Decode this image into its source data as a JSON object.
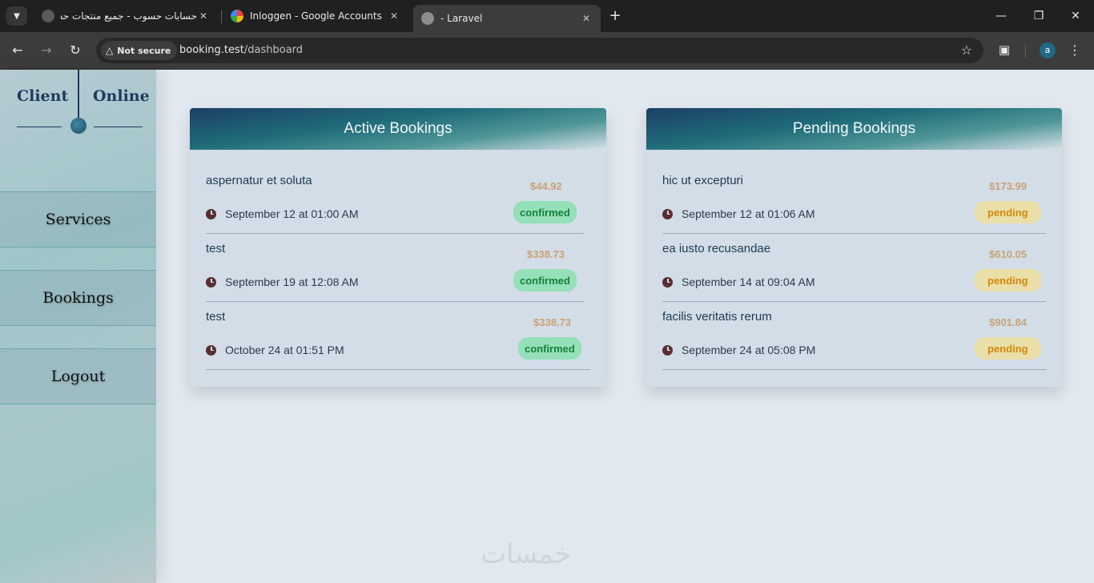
{
  "browser": {
    "tabs": [
      {
        "title": "حسابات حسوب - جميع منتجات حسوب"
      },
      {
        "title": "Inloggen - Google Accounts"
      },
      {
        "title": "- Laravel"
      }
    ],
    "security_chip": "Not secure",
    "url_host": "booking.test",
    "url_path": "/dashboard",
    "profile_initial": "a"
  },
  "sidebar": {
    "logo_left": "Client",
    "logo_right": "Online",
    "items": [
      {
        "label": "Services"
      },
      {
        "label": "Bookings"
      },
      {
        "label": "Logout"
      }
    ]
  },
  "active_bookings": {
    "title": "Active Bookings",
    "items": [
      {
        "name": "aspernatur et soluta",
        "datetime": "September 12 at 01:00 AM",
        "price": "$44.92",
        "status": "confirmed"
      },
      {
        "name": "test",
        "datetime": "September 19 at 12:08 AM",
        "price": "$338.73",
        "status": "confirmed"
      },
      {
        "name": "test",
        "datetime": "October 24 at 01:51 PM",
        "price": "$338.73",
        "status": "confirmed"
      }
    ]
  },
  "pending_bookings": {
    "title": "Pending Bookings",
    "items": [
      {
        "name": "hic ut excepturi",
        "datetime": "September 12 at 01:06 AM",
        "price": "$173.99",
        "status": "pending"
      },
      {
        "name": "ea iusto recusandae",
        "datetime": "September 14 at 09:04 AM",
        "price": "$610.05",
        "status": "pending"
      },
      {
        "name": "facilis veritatis rerum",
        "datetime": "September 24 at 05:08 PM",
        "price": "$901.84",
        "status": "pending"
      }
    ]
  },
  "watermark": "خمسات",
  "colors": {
    "confirmed_bg": "#95e0b8",
    "confirmed_text": "#15803d",
    "pending_bg": "#eadfa8",
    "pending_text": "#d4880b",
    "price": "#c9a276"
  }
}
